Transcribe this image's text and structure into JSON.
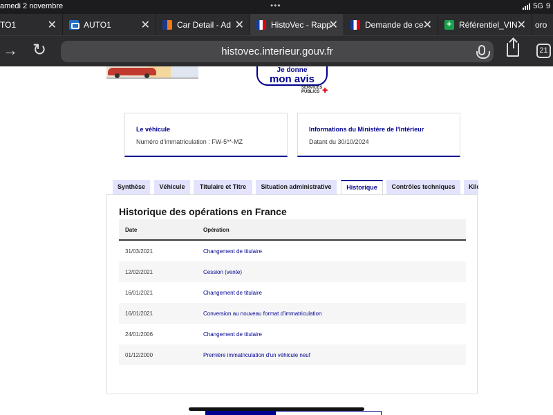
{
  "status_bar": {
    "date": "amedi 2 novembre",
    "network": "5G",
    "battery": "9"
  },
  "browser_tabs": [
    {
      "title": "TO1"
    },
    {
      "title": "AUTO1"
    },
    {
      "title": "Car Detail - Ad"
    },
    {
      "title": "HistoVec - Rapp"
    },
    {
      "title": "Demande de ce"
    },
    {
      "title": "Référentiel_VIN"
    },
    {
      "title": "oro"
    }
  ],
  "address_bar": {
    "url": "histovec.interieur.gouv.fr",
    "tab_count": "21"
  },
  "header": {
    "avis_line1": "Je donne",
    "avis_line2": "mon avis",
    "services_line1": "SERVICES",
    "services_line2": "PUBLICS"
  },
  "cards": [
    {
      "title": "Le véhicule",
      "value": "Numéro d'immatriculation : FW-5**-MZ"
    },
    {
      "title": "Informations du Ministère de l'Intérieur",
      "value": "Datant du 30/10/2024"
    }
  ],
  "page_tabs": [
    {
      "label": "Synthèse"
    },
    {
      "label": "Véhicule"
    },
    {
      "label": "Titulaire et Titre"
    },
    {
      "label": "Situation administrative"
    },
    {
      "label": "Historique"
    },
    {
      "label": "Contrôles techniques"
    },
    {
      "label": "Kilo"
    }
  ],
  "history": {
    "title": "Historique des opérations en France",
    "columns": [
      "Date",
      "Opération"
    ],
    "rows": [
      {
        "date": "31/03/2021",
        "operation": "Changement de titulaire"
      },
      {
        "date": "12/02/2021",
        "operation": "Cession (vente)"
      },
      {
        "date": "16/01/2021",
        "operation": "Changement de titulaire"
      },
      {
        "date": "16/01/2021",
        "operation": "Conversion au nouveau format d'immatriculation"
      },
      {
        "date": "24/01/2006",
        "operation": "Changement de titulaire"
      },
      {
        "date": "01/12/2000",
        "operation": "Première immatriculation d'un véhicule neuf"
      }
    ]
  },
  "colors": {
    "accent": "#000091",
    "tab_bg": "#e3e3fd",
    "marianne_red": "#e1000f"
  }
}
